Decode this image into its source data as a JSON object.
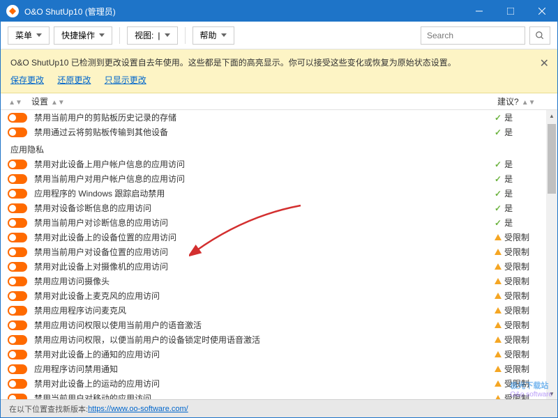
{
  "titlebar": {
    "title": "O&O ShutUp10 (管理员)"
  },
  "toolbar": {
    "menu": "菜单",
    "quick": "快捷操作",
    "view": "视图:",
    "help": "帮助",
    "search_placeholder": "Search"
  },
  "notice": {
    "text": "O&O ShutUp10 已检测到更改设置自去年使用。这些都是下面的高亮显示。你可以接受这些变化或恢复为原始状态设置。",
    "save": "保存更改",
    "revert": "还原更改",
    "showonly": "只显示更改"
  },
  "headers": {
    "setting": "设置",
    "recommend": "建议?"
  },
  "section": {
    "app_privacy": "应用隐私"
  },
  "rows": [
    {
      "label": "禁用当前用户的剪贴板历史记录的存储",
      "rec": "yes",
      "rec_text": "是"
    },
    {
      "label": "禁用通过云将剪贴板传输到其他设备",
      "rec": "yes",
      "rec_text": "是"
    }
  ],
  "rows2": [
    {
      "label": "禁用对此设备上用户帐户信息的应用访问",
      "rec": "yes",
      "rec_text": "是"
    },
    {
      "label": "禁用当前用户对用户帐户信息的应用访问",
      "rec": "yes",
      "rec_text": "是"
    },
    {
      "label": "应用程序的 Windows 跟踪启动禁用",
      "rec": "yes",
      "rec_text": "是"
    },
    {
      "label": "禁用对设备诊断信息的应用访问",
      "rec": "yes",
      "rec_text": "是"
    },
    {
      "label": "禁用当前用户对诊断信息的应用访问",
      "rec": "yes",
      "rec_text": "是"
    },
    {
      "label": "禁用对此设备上的设备位置的应用访问",
      "rec": "limited",
      "rec_text": "受限制"
    },
    {
      "label": "禁用当前用户对设备位置的应用访问",
      "rec": "limited",
      "rec_text": "受限制"
    },
    {
      "label": "禁用对此设备上对摄像机的应用访问",
      "rec": "limited",
      "rec_text": "受限制"
    },
    {
      "label": "禁用应用访问摄像头",
      "rec": "limited",
      "rec_text": "受限制"
    },
    {
      "label": "禁用对此设备上麦克风的应用访问",
      "rec": "limited",
      "rec_text": "受限制"
    },
    {
      "label": "禁用应用程序访问麦克风",
      "rec": "limited",
      "rec_text": "受限制"
    },
    {
      "label": "禁用应用访问权限以使用当前用户的语音激活",
      "rec": "limited",
      "rec_text": "受限制"
    },
    {
      "label": "禁用应用访问权限，以便当前用户的设备锁定时使用语音激活",
      "rec": "limited",
      "rec_text": "受限制"
    },
    {
      "label": "禁用对此设备上的通知的应用访问",
      "rec": "limited",
      "rec_text": "受限制"
    },
    {
      "label": "应用程序访问禁用通知",
      "rec": "limited",
      "rec_text": "受限制"
    },
    {
      "label": "禁用对此设备上的运动的应用访问",
      "rec": "limited",
      "rec_text": "受限制"
    },
    {
      "label": "禁用当前用户对移动的应用访问",
      "rec": "limited",
      "rec_text": "受限制"
    }
  ],
  "footer": {
    "text": "在以下位置查找新版本: ",
    "url": "https://www.oo-software.com/"
  },
  "watermark": {
    "line1": "极光下载站",
    "line2": "O&o software"
  }
}
